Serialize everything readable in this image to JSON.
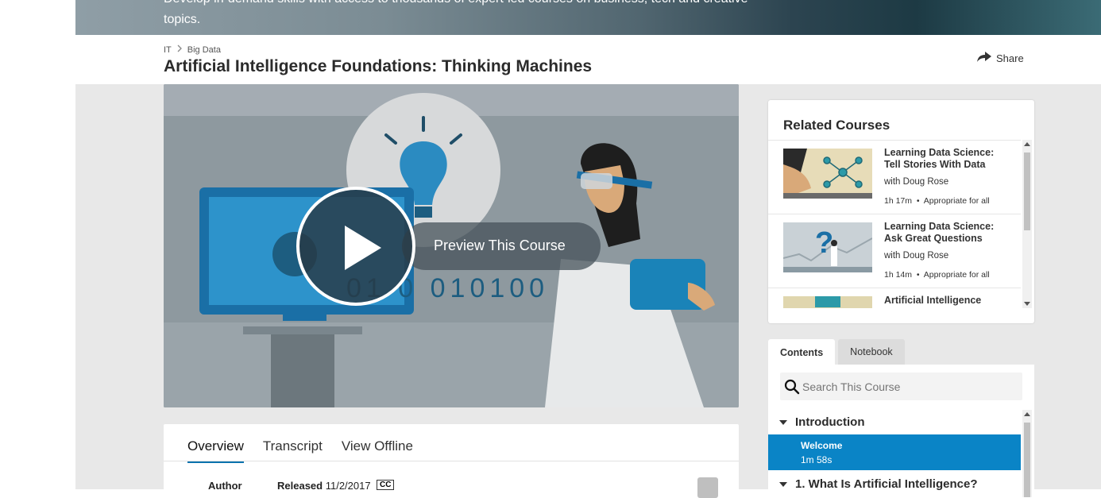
{
  "hero": {
    "text": "Develop in-demand skills with access to thousands of expert-led courses on business, tech and creative topics."
  },
  "breadcrumb": {
    "items": [
      "IT",
      "Big Data"
    ]
  },
  "course": {
    "title": "Artificial Intelligence Foundations: Thinking Machines"
  },
  "share": {
    "label": "Share"
  },
  "video": {
    "preview_label": "Preview This Course",
    "binary_text": "01 0 010100"
  },
  "detail_tabs": [
    "Overview",
    "Transcript",
    "View Offline"
  ],
  "meta": {
    "author_label": "Author",
    "released_label": "Released",
    "released_value": "11/2/2017",
    "cc_label": "CC"
  },
  "related": {
    "heading": "Related Courses",
    "items": [
      {
        "title": "Learning Data Science: Tell Stories With Data",
        "author": "with Doug Rose",
        "duration": "1h 17m",
        "level": "Appropriate for all"
      },
      {
        "title": "Learning Data Science: Ask Great Questions",
        "author": "with Doug Rose",
        "duration": "1h 14m",
        "level": "Appropriate for all"
      },
      {
        "title": "Artificial Intelligence"
      }
    ]
  },
  "content_tabs": [
    "Contents",
    "Notebook"
  ],
  "contents": {
    "search_placeholder": "Search This Course",
    "chapters": [
      {
        "title": "Introduction",
        "videos": [
          {
            "title": "Welcome",
            "duration": "1m 58s"
          }
        ]
      },
      {
        "title": "1. What Is Artificial Intelligence?"
      }
    ]
  },
  "colors": {
    "accent": "#0a84c6",
    "tab_underline": "#0a73ae",
    "page_bg": "#e8e8e8"
  }
}
